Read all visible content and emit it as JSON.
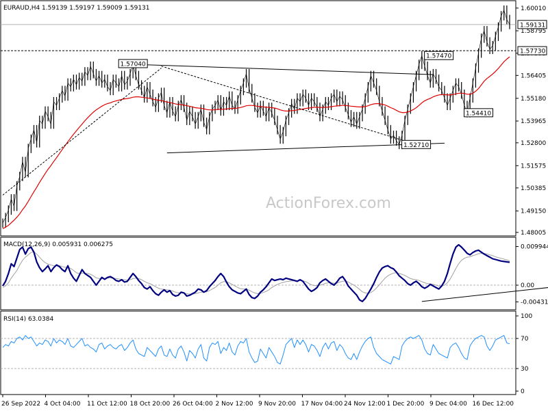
{
  "chart_data": {
    "type": "line",
    "symbol_header": "EURAUD,H4  1.59139 1.59197 1.59009 1.59131",
    "watermark": "ActionForex.com",
    "x_labels": [
      "26 Sep 2022",
      "4 Oct 04:00",
      "11 Oct 12:00",
      "18 Oct 20:00",
      "26 Oct 04:00",
      "2 Nov 12:00",
      "9 Nov 20:00",
      "17 Nov 04:00",
      "24 Nov 12:00",
      "1 Dec 20:00",
      "9 Dec 04:00",
      "16 Dec 12:00"
    ],
    "main": {
      "ylim": [
        1.48,
        1.6015
      ],
      "y_ticks": [
        "1.60010",
        "1.58795",
        "1.57595",
        "1.56405",
        "1.55180",
        "1.53965",
        "1.52800",
        "1.51575",
        "1.50385",
        "1.49150",
        "1.48005"
      ],
      "price_tag": "1.59131",
      "price_value": 1.59131,
      "level_tag": "1.57730",
      "level_value": 1.5773,
      "annotations": [
        {
          "text": "1.57040",
          "x": 46,
          "y": 1.5704
        },
        {
          "text": "1.57470",
          "x": 154,
          "y": 1.5747
        },
        {
          "text": "1.52710",
          "x": 146,
          "y": 1.5271
        },
        {
          "text": "1.54410",
          "x": 168,
          "y": 1.5441
        }
      ],
      "trendlines": [
        {
          "name": "upper channel",
          "x1": 46,
          "y1": 1.57,
          "x2": 152,
          "y2": 1.5645
        },
        {
          "name": "lower channel",
          "x1": 58,
          "y1": 1.5226,
          "x2": 156,
          "y2": 1.5278
        },
        {
          "name": "dashed trendline",
          "x1": 0,
          "y1": 1.5,
          "x2": 56,
          "y2": 1.568,
          "dashed": true
        },
        {
          "name": "dashed falling line",
          "x1": 56,
          "y1": 1.569,
          "x2": 142,
          "y2": 1.529,
          "dashed": true
        }
      ],
      "price_series": {
        "name": "EURAUD",
        "values": [
          1.485,
          1.488,
          1.492,
          1.498,
          1.494,
          1.505,
          1.51,
          1.518,
          1.512,
          1.525,
          1.53,
          1.535,
          1.528,
          1.54,
          1.538,
          1.545,
          1.542,
          1.538,
          1.55,
          1.548,
          1.552,
          1.556,
          1.553,
          1.56,
          1.558,
          1.562,
          1.559,
          1.563,
          1.561,
          1.566,
          1.564,
          1.569,
          1.565,
          1.561,
          1.564,
          1.56,
          1.562,
          1.558,
          1.556,
          1.562,
          1.56,
          1.558,
          1.564,
          1.559,
          1.561,
          1.565,
          1.57,
          1.564,
          1.559,
          1.556,
          1.552,
          1.558,
          1.554,
          1.55,
          1.547,
          1.552,
          1.555,
          1.548,
          1.544,
          1.55,
          1.545,
          1.542,
          1.548,
          1.551,
          1.547,
          1.54,
          1.545,
          1.542,
          1.538,
          1.542,
          1.546,
          1.539,
          1.535,
          1.542,
          1.546,
          1.548,
          1.551,
          1.545,
          1.55,
          1.548,
          1.553,
          1.548,
          1.546,
          1.551,
          1.556,
          1.56,
          1.565,
          1.557,
          1.552,
          1.547,
          1.544,
          1.548,
          1.545,
          1.542,
          1.547,
          1.544,
          1.54,
          1.535,
          1.53,
          1.534,
          1.54,
          1.544,
          1.549,
          1.546,
          1.552,
          1.55,
          1.554,
          1.552,
          1.548,
          1.552,
          1.55,
          1.547,
          1.542,
          1.546,
          1.55,
          1.548,
          1.552,
          1.554,
          1.55,
          1.553,
          1.551,
          1.547,
          1.543,
          1.539,
          1.542,
          1.538,
          1.542,
          1.546,
          1.552,
          1.558,
          1.564,
          1.56,
          1.556,
          1.55,
          1.545,
          1.54,
          1.535,
          1.53,
          1.532,
          1.529,
          1.5271,
          1.532,
          1.54,
          1.546,
          1.552,
          1.558,
          1.564,
          1.57,
          1.5747,
          1.569,
          1.564,
          1.56,
          1.565,
          1.562,
          1.558,
          1.556,
          1.552,
          1.548,
          1.552,
          1.556,
          1.56,
          1.558,
          1.554,
          1.548,
          1.5441,
          1.552,
          1.56,
          1.568,
          1.576,
          1.584,
          1.588,
          1.582,
          1.578,
          1.58,
          1.585,
          1.59,
          1.596,
          1.599,
          1.594,
          1.5913
        ]
      },
      "ma_series": {
        "name": "moving average",
        "color": "#e00000",
        "values": [
          1.482,
          1.4828,
          1.4838,
          1.4852,
          1.4866,
          1.4882,
          1.49,
          1.4922,
          1.4942,
          1.4966,
          1.4992,
          1.5018,
          1.5042,
          1.5068,
          1.5092,
          1.5116,
          1.5138,
          1.5158,
          1.518,
          1.52,
          1.5222,
          1.5244,
          1.5264,
          1.5286,
          1.5306,
          1.5326,
          1.5344,
          1.5362,
          1.538,
          1.5398,
          1.5414,
          1.543,
          1.5444,
          1.5456,
          1.5466,
          1.5476,
          1.5484,
          1.549,
          1.5494,
          1.55,
          1.5504,
          1.5508,
          1.5512,
          1.5515,
          1.5517,
          1.552,
          1.5524,
          1.5526,
          1.5526,
          1.5524,
          1.5522,
          1.552,
          1.5518,
          1.5514,
          1.551,
          1.5508,
          1.5506,
          1.5502,
          1.5498,
          1.5496,
          1.5492,
          1.5488,
          1.5485,
          1.5484,
          1.5482,
          1.5478,
          1.5476,
          1.5472,
          1.5468,
          1.5466,
          1.5465,
          1.5462,
          1.5458,
          1.5456,
          1.5456,
          1.5457,
          1.5459,
          1.5459,
          1.546,
          1.5461,
          1.5463,
          1.5464,
          1.5464,
          1.5466,
          1.5469,
          1.5473,
          1.5478,
          1.548,
          1.548,
          1.5478,
          1.5475,
          1.5474,
          1.5472,
          1.547,
          1.547,
          1.5468,
          1.5466,
          1.5462,
          1.5456,
          1.5452,
          1.545,
          1.545,
          1.5452,
          1.5453,
          1.5456,
          1.5458,
          1.5461,
          1.5464,
          1.5466,
          1.5468,
          1.547,
          1.547,
          1.5469,
          1.5469,
          1.547,
          1.5471,
          1.5473,
          1.5476,
          1.5477,
          1.5479,
          1.548,
          1.548,
          1.5478,
          1.5476,
          1.5475,
          1.5473,
          1.5472,
          1.5472,
          1.5474,
          1.5478,
          1.5484,
          1.5488,
          1.549,
          1.5489,
          1.5486,
          1.5482,
          1.5476,
          1.5468,
          1.5462,
          1.5454,
          1.5446,
          1.5442,
          1.5442,
          1.5445,
          1.545,
          1.5458,
          1.5468,
          1.548,
          1.5494,
          1.5505,
          1.5512,
          1.5518,
          1.5526,
          1.5532,
          1.5536,
          1.5538,
          1.5538,
          1.5536,
          1.5536,
          1.5538,
          1.5542,
          1.5545,
          1.5546,
          1.5544,
          1.554,
          1.554,
          1.5545,
          1.5556,
          1.557,
          1.559,
          1.561,
          1.5624,
          1.5636,
          1.5648,
          1.5662,
          1.5678,
          1.5696,
          1.5714,
          1.5728,
          1.574
        ]
      }
    },
    "macd": {
      "label": "MACD(12,26,9) 0.005931 0.006275",
      "ylim": [
        -0.0058,
        0.0118
      ],
      "y_ticks": [
        "0.009944",
        "0.00",
        "-0.004313"
      ],
      "trendline": {
        "x1": 148,
        "y1": -0.0042,
        "x2": 199,
        "y2": -0.0001
      },
      "macd_series": {
        "name": "MACD",
        "color": "#000080",
        "values": [
          -0.0002,
          0.001,
          0.003,
          0.0055,
          0.0048,
          0.007,
          0.0092,
          0.0098,
          0.008,
          0.0094,
          0.0098,
          0.0085,
          0.006,
          0.0045,
          0.0035,
          0.0042,
          0.005,
          0.0035,
          0.0045,
          0.0052,
          0.0048,
          0.004,
          0.0035,
          0.005,
          0.003,
          0.0018,
          0.001,
          0.0025,
          0.004,
          0.003,
          0.0025,
          0.002,
          0.001,
          0.0,
          0.001,
          0.002,
          0.0015,
          0.002,
          0.0022,
          0.0018,
          0.0012,
          0.001,
          0.0014,
          0.0008,
          0.001,
          0.002,
          0.003,
          0.0022,
          0.0012,
          0.0004,
          -0.0006,
          -0.001,
          -0.0004,
          -0.0014,
          -0.0022,
          -0.0026,
          -0.0018,
          -0.0012,
          -0.0018,
          -0.0014,
          -0.0024,
          -0.0028,
          -0.0026,
          -0.0018,
          -0.002,
          -0.0028,
          -0.0026,
          -0.0022,
          -0.0018,
          -0.001,
          -0.0012,
          -0.0018,
          -0.0014,
          -0.0004,
          0.0004,
          0.0012,
          0.0022,
          0.003,
          0.0022,
          0.0008,
          -0.0004,
          -0.0012,
          -0.0016,
          -0.002,
          -0.0022,
          -0.0016,
          -0.001,
          -0.0024,
          -0.0032,
          -0.0034,
          -0.0028,
          -0.0018,
          -0.0012,
          -0.0004,
          0.0006,
          0.0016,
          0.0012,
          0.0014,
          0.0016,
          0.0014,
          0.0018,
          0.0016,
          0.0014,
          0.0012,
          0.001,
          0.0014,
          0.001,
          0.0,
          -0.001,
          -0.0016,
          -0.0012,
          -0.0006,
          0.0006,
          0.0012,
          0.0016,
          0.001,
          0.0004,
          0.0,
          0.0008,
          0.0018,
          0.0022,
          0.0012,
          -0.0002,
          -0.001,
          -0.0018,
          -0.0026,
          -0.0038,
          -0.0042,
          -0.0034,
          -0.0022,
          -0.001,
          0.0004,
          0.002,
          0.0034,
          0.0044,
          0.0048,
          0.005,
          0.0045,
          0.0042,
          0.0034,
          0.0024,
          0.0018,
          0.0012,
          0.0004,
          0.0,
          0.0006,
          0.001,
          0.0004,
          -0.0004,
          -0.0008,
          -0.0004,
          0.0002,
          -0.0002,
          -0.0006,
          -0.001,
          -0.0002,
          0.001,
          0.003,
          0.0056,
          0.008,
          0.0098,
          0.0104,
          0.0098,
          0.009,
          0.0082,
          0.0078,
          0.0084,
          0.0088,
          0.009,
          0.0085,
          0.008,
          0.0076,
          0.0072,
          0.0068,
          0.0066,
          0.0064,
          0.0062,
          0.0061,
          0.006,
          0.0059
        ]
      },
      "signal_series": {
        "name": "Signal",
        "color": "#a0a0a0",
        "values": [
          -0.0006,
          -0.0002,
          0.0006,
          0.0018,
          0.0028,
          0.0038,
          0.0052,
          0.0064,
          0.0072,
          0.0078,
          0.0084,
          0.0086,
          0.008,
          0.0072,
          0.0064,
          0.0058,
          0.0054,
          0.0052,
          0.005,
          0.005,
          0.005,
          0.0048,
          0.0046,
          0.0046,
          0.0043,
          0.0038,
          0.0032,
          0.003,
          0.0031,
          0.0031,
          0.003,
          0.0028,
          0.0024,
          0.0019,
          0.0017,
          0.0017,
          0.0017,
          0.0018,
          0.0019,
          0.0018,
          0.0017,
          0.0016,
          0.0015,
          0.0014,
          0.0013,
          0.0014,
          0.0017,
          0.0018,
          0.0017,
          0.0014,
          0.001,
          0.0006,
          0.0004,
          0.0,
          -0.0004,
          -0.0008,
          -0.001,
          -0.0011,
          -0.0012,
          -0.0013,
          -0.0015,
          -0.0018,
          -0.002,
          -0.002,
          -0.002,
          -0.0022,
          -0.0023,
          -0.0023,
          -0.0022,
          -0.002,
          -0.0018,
          -0.0018,
          -0.0017,
          -0.0014,
          -0.001,
          -0.0006,
          0.0,
          0.0006,
          0.0009,
          0.0009,
          0.0006,
          0.0002,
          -0.0002,
          -0.0006,
          -0.0009,
          -0.001,
          -0.001,
          -0.0013,
          -0.0017,
          -0.002,
          -0.0022,
          -0.0021,
          -0.0019,
          -0.0016,
          -0.0012,
          -0.0006,
          -0.0002,
          0.0002,
          0.0005,
          0.0007,
          0.0009,
          0.001,
          0.0011,
          0.0011,
          0.0011,
          0.0012,
          0.0011,
          0.0009,
          0.0005,
          0.0001,
          -0.0001,
          -0.0002,
          0.0,
          0.0002,
          0.0005,
          0.0006,
          0.0006,
          0.0005,
          0.0005,
          0.0008,
          0.001,
          0.0011,
          0.0008,
          0.0004,
          0.0,
          -0.0005,
          -0.0011,
          -0.0017,
          -0.002,
          -0.0021,
          -0.0019,
          -0.0014,
          -0.0007,
          0.0001,
          0.001,
          0.0018,
          0.0024,
          0.0028,
          0.0031,
          0.0032,
          0.003,
          0.0028,
          0.0025,
          0.0021,
          0.0017,
          0.0015,
          0.0014,
          0.0012,
          0.0009,
          0.0006,
          0.0004,
          0.0003,
          0.0002,
          0.0,
          -0.0002,
          -0.0002,
          0.0,
          0.0006,
          0.0016,
          0.0029,
          0.0043,
          0.0055,
          0.0064,
          0.0069,
          0.0072,
          0.0073,
          0.0076,
          0.0078,
          0.0081,
          0.0082,
          0.0082,
          0.008,
          0.0078,
          0.0076,
          0.0073,
          0.0071,
          0.0069,
          0.0067,
          0.0065,
          0.0063
        ]
      }
    },
    "rsi": {
      "label": "RSI(14) 63.0384",
      "ylim": [
        0,
        100
      ],
      "y_ticks": [
        "100",
        "70",
        "30",
        "0"
      ],
      "levels": [
        70,
        30
      ],
      "color": "#1e90ff",
      "values": [
        58,
        62,
        60,
        66,
        64,
        70,
        72,
        68,
        74,
        70,
        72,
        66,
        60,
        64,
        62,
        68,
        66,
        60,
        70,
        64,
        68,
        66,
        62,
        70,
        60,
        58,
        62,
        66,
        70,
        60,
        62,
        58,
        56,
        52,
        62,
        64,
        56,
        60,
        62,
        58,
        56,
        60,
        62,
        54,
        58,
        64,
        68,
        56,
        50,
        48,
        46,
        58,
        54,
        50,
        46,
        56,
        60,
        48,
        46,
        56,
        48,
        44,
        56,
        60,
        52,
        40,
        54,
        50,
        44,
        56,
        62,
        44,
        40,
        58,
        64,
        62,
        66,
        50,
        58,
        54,
        64,
        52,
        48,
        60,
        66,
        64,
        70,
        52,
        44,
        38,
        40,
        56,
        50,
        44,
        58,
        52,
        46,
        38,
        36,
        48,
        62,
        66,
        70,
        58,
        68,
        62,
        68,
        62,
        52,
        62,
        60,
        54,
        46,
        58,
        64,
        56,
        64,
        66,
        54,
        62,
        58,
        50,
        44,
        42,
        50,
        42,
        52,
        60,
        66,
        70,
        72,
        58,
        50,
        46,
        42,
        40,
        38,
        36,
        46,
        44,
        42,
        60,
        66,
        70,
        72,
        70,
        72,
        74,
        68,
        56,
        50,
        48,
        62,
        56,
        50,
        48,
        46,
        44,
        58,
        62,
        64,
        58,
        50,
        44,
        42,
        60,
        66,
        70,
        72,
        74,
        72,
        60,
        54,
        60,
        68,
        70,
        72,
        74,
        64,
        63
      ]
    }
  }
}
